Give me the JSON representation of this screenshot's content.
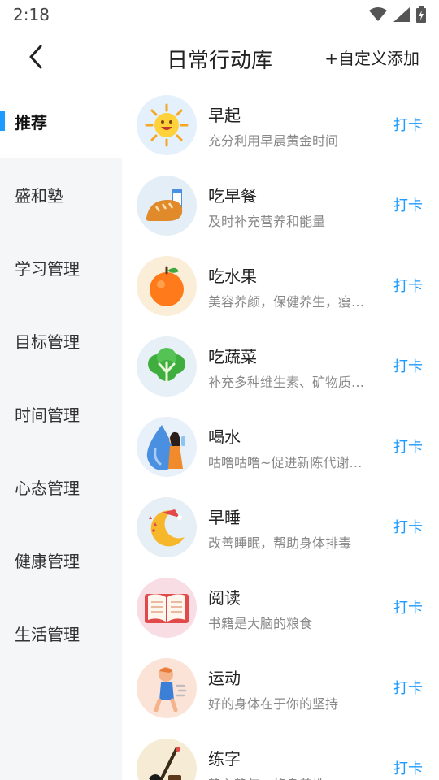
{
  "status": {
    "time": "2:18"
  },
  "header": {
    "title": "日常行动库",
    "add_label": "+自定义添加"
  },
  "sidebar": {
    "items": [
      {
        "label": "推荐"
      },
      {
        "label": "盛和塾"
      },
      {
        "label": "学习管理"
      },
      {
        "label": "目标管理"
      },
      {
        "label": "时间管理"
      },
      {
        "label": "心态管理"
      },
      {
        "label": "健康管理"
      },
      {
        "label": "生活管理"
      }
    ]
  },
  "list": {
    "action_label": "打卡",
    "items": [
      {
        "title": "早起",
        "subtitle": "充分利用早晨黄金时间",
        "icon": "sun-icon"
      },
      {
        "title": "吃早餐",
        "subtitle": "及时补充营养和能量",
        "icon": "bread-icon"
      },
      {
        "title": "吃水果",
        "subtitle": "美容养颜，保健养生，瘦…",
        "icon": "fruit-icon"
      },
      {
        "title": "吃蔬菜",
        "subtitle": "补充多种维生素、矿物质…",
        "icon": "vegetable-icon"
      },
      {
        "title": "喝水",
        "subtitle": "咕噜咕噜~促进新陈代谢…",
        "icon": "water-icon"
      },
      {
        "title": "早睡",
        "subtitle": "改善睡眠，帮助身体排毒",
        "icon": "moon-icon"
      },
      {
        "title": "阅读",
        "subtitle": "书籍是大脑的粮食",
        "icon": "book-icon"
      },
      {
        "title": "运动",
        "subtitle": "好的身体在于你的坚持",
        "icon": "runner-icon"
      },
      {
        "title": "练字",
        "subtitle": "静心静气，修身养性",
        "icon": "calligraphy-icon"
      }
    ]
  }
}
